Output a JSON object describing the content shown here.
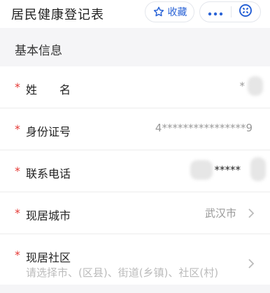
{
  "header": {
    "title": "居民健康登记表",
    "favorite_label": "收藏",
    "accent_color": "#2a63d6",
    "icons": {
      "favorite": "star-outline-icon",
      "more": "more-dots-icon",
      "close": "close-circle-icon"
    }
  },
  "section": {
    "title": "基本信息"
  },
  "form": {
    "required_mark": "*",
    "fields": [
      {
        "label": "姓　　名",
        "value": "*"
      },
      {
        "label": "身份证号",
        "value": "4****************9"
      },
      {
        "label": "联系电话",
        "value": "*****"
      },
      {
        "label": "现居城市",
        "value": "武汉市"
      },
      {
        "label": "现居社区",
        "placeholder": "请选择市、(区县)、街道(乡镇)、社区(村)"
      }
    ]
  },
  "colors": {
    "required": "#e53935",
    "value_gray": "#999999",
    "placeholder": "#bbbbbb"
  }
}
